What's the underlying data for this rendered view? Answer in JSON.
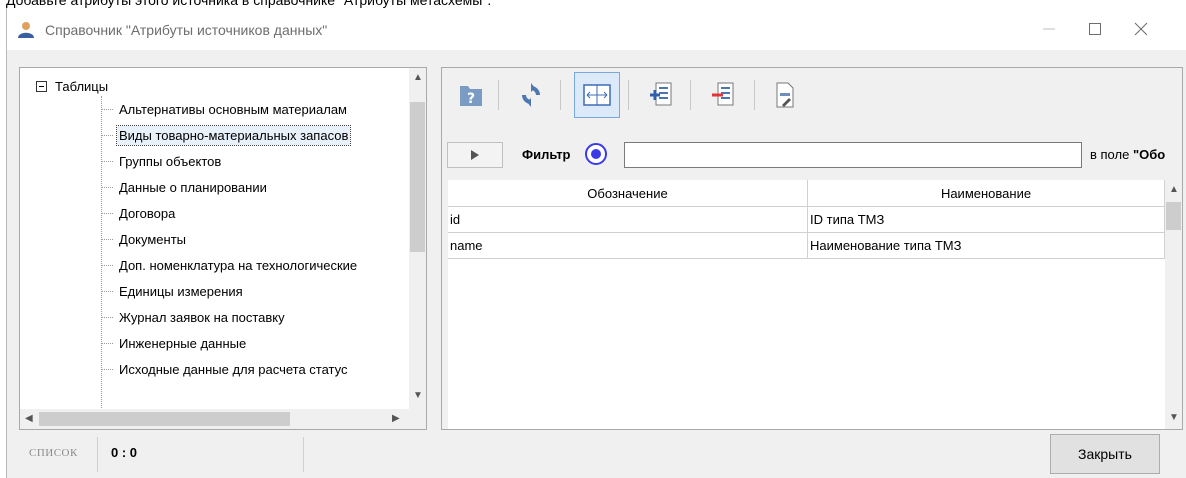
{
  "top_text": "Добавьте атрибуты этого источника в справочнике \"Атрибуты метасхемы\".",
  "window": {
    "title": "Справочник \"Атрибуты источников данных\"",
    "icons": [
      "user-icon",
      "minimize-icon",
      "maximize-icon",
      "close-icon"
    ]
  },
  "tree": {
    "root_label": "Таблицы",
    "items": [
      "Альтернативы основным материалам",
      "Виды товарно-материальных запасов",
      "Группы объектов",
      "Данные о планировании",
      "Договора",
      "Документы",
      "Доп. номенклатура на технологические",
      "Единицы измерения",
      "Журнал заявок на поставку",
      "Инженерные данные",
      "Исходные данные для расчета статус"
    ],
    "selected_index": 1
  },
  "toolbar": {
    "buttons": [
      "help-icon",
      "refresh-icon",
      "fit-columns-icon",
      "add-row-icon",
      "delete-row-icon",
      "export-icon"
    ],
    "active_button": "fit-columns-icon"
  },
  "filter": {
    "label": "Фильтр",
    "value": "",
    "in_field_prefix": "в поле ",
    "in_field_name": "\"Обо"
  },
  "grid": {
    "columns": [
      "Обозначение",
      "Наименование"
    ],
    "rows": [
      [
        "id",
        "ID типа ТМЗ"
      ],
      [
        "name",
        "Наименование типа ТМЗ"
      ]
    ]
  },
  "status": {
    "list_label": "СПИСОК",
    "count": "0 : 0",
    "close_label": "Закрыть"
  }
}
